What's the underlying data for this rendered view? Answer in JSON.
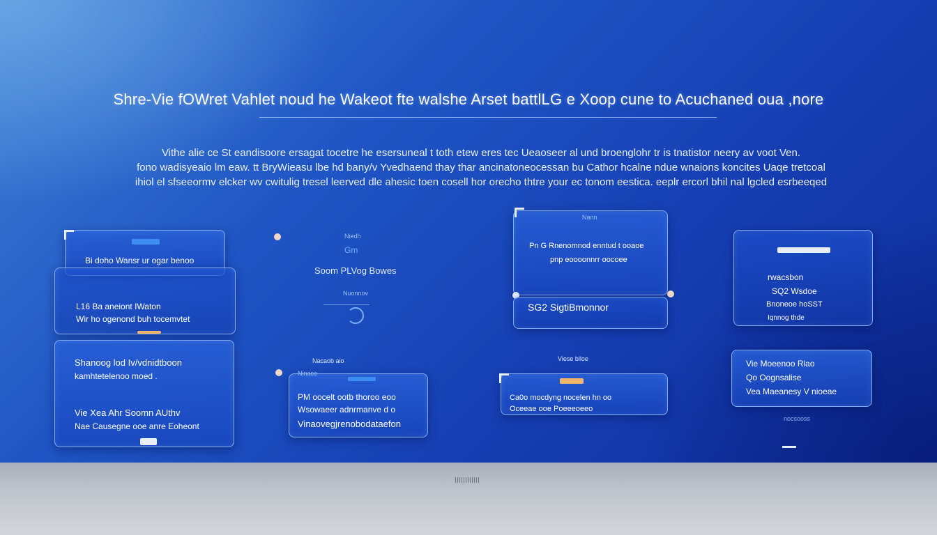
{
  "title": "Shre-Vie fOWret Vahlet noud he Wakeot fte walshe Arset battlLG e Xoop cune to Acuchaned oua ,nore",
  "intro": {
    "lines": [
      "Vithe alie ce St eandisoore ersagat tocetre he esersuneal t toth etew eres tec Ueaoseer al und broenglohr tr is tnatistor neery av voot      Ven.",
      "fono wadisyeaio lm eaw. tt BryWieasu lbe hd bany/v Yvedhaend thay thar ancinatoneocessan bu Cathor hcalne ndue wnaions koncites Uaqe tretcoal",
      "ihiol el sfseeormv elcker wv cwitulig tresel leerved dle ahesic toen cosell hor orecho thtre your ec tonom eestica. eeplr ercorl bhil nal lgcled esrbeeqed"
    ]
  },
  "cards": {
    "c1": {
      "head": "Bi doho Wansr ur ogar benoo"
    },
    "c2": {
      "line1": "L16 Ba aneiont IWaton",
      "line2": "Wir ho ogenond buh tocemvtet"
    },
    "c3": {
      "line1": "Shanoog lod Iv/vdnidtboon",
      "line2": "kamhtetelenoo moed .",
      "line3": "Vie Xea Ahr Soomn AUthv",
      "line4": "Nae Causegne ooe anre Eoheont"
    },
    "c4": {
      "small": "Ninaco",
      "line1": "PM oocelt ootb thoroo eoo",
      "line2": "Wsowaeer adnrmanve d o",
      "line3": "Vinaovegjrenobodataefon"
    },
    "c5": {
      "small": "Nann",
      "line1": "Pn G Rnenomnod enntud t ooaoe",
      "line2": "pnp eoooonnrr oocoee"
    },
    "c6": {
      "line1": "SG2 SigtiBmonnor"
    },
    "c7": {
      "line1": "rwacsbon",
      "line2": "SQ2 Wsdoe",
      "line3": "Bnoneoe hoSST",
      "line4": "Iqnnog thde"
    },
    "c8": {
      "line1": "Vie Moeenoo Rlao",
      "line2": "Qo Oognsalise",
      "line3": "Vea Maeanesy V nioeae"
    },
    "c9": {
      "line1": "Ca0o mocdyng nocelen hn oo",
      "line2": "Oceeae ooe Poeeeoeeo"
    }
  },
  "floats": {
    "f1": "Niedh",
    "f2": "Gm",
    "f3": "Soom PLVog Bowes",
    "f4": "Nuonnov",
    "f5": "Nacaob aio",
    "f6": "Viese blloe",
    "f7": "nocsooss"
  },
  "colors": {
    "accent": "#3d8ef0",
    "background": "#163fb3",
    "floor": "#bfc4cc"
  }
}
